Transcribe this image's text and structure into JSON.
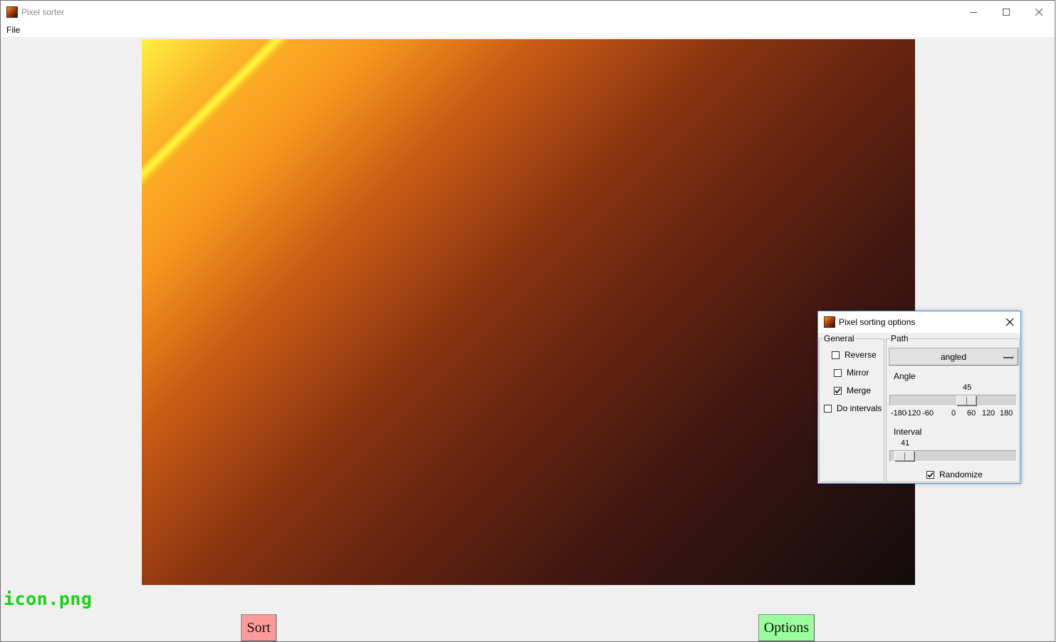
{
  "window": {
    "title": "Pixel sorter",
    "icon": "pixel-sorter-app-icon"
  },
  "menu": {
    "file": "File"
  },
  "image": {
    "filename": "icon.png"
  },
  "buttons": {
    "sort": "Sort",
    "options": "Options",
    "sort_color": "#ff9a9a",
    "options_color": "#9aff9a"
  },
  "dialog": {
    "title": "Pixel sorting options",
    "general": {
      "label": "General",
      "reverse": {
        "label": "Reverse",
        "checked": false
      },
      "mirror": {
        "label": "Mirror",
        "checked": false
      },
      "merge": {
        "label": "Merge",
        "checked": true
      },
      "do_intervals": {
        "label": "Do intervals",
        "checked": false
      }
    },
    "path": {
      "label": "Path",
      "selected": "angled",
      "angle": {
        "label": "Angle",
        "value": "45",
        "min": -180,
        "max": 180,
        "ticks": [
          "-180",
          "-120",
          "-60",
          "0",
          "60",
          "120",
          "180"
        ]
      },
      "interval": {
        "label": "Interval",
        "value": "41"
      },
      "randomize": {
        "label": "Randomize",
        "checked": true
      }
    }
  }
}
